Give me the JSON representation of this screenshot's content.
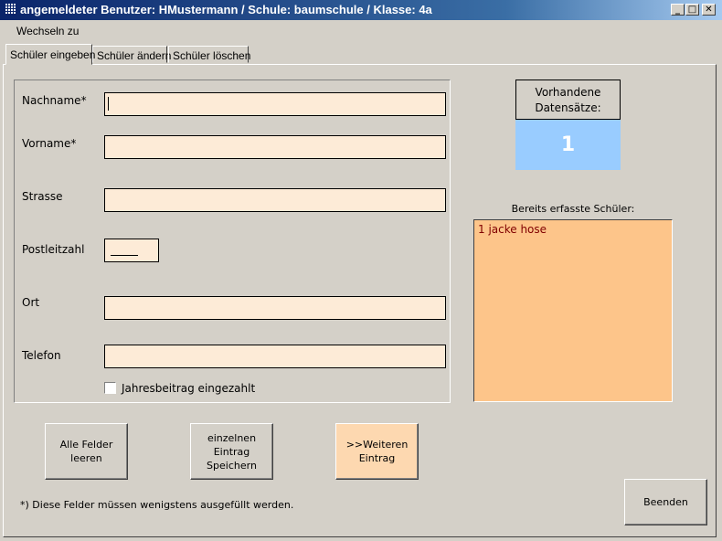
{
  "window": {
    "title": "angemeldeter Benutzer: HMustermann / Schule: baumschule / Klasse: 4a",
    "minimize": "_",
    "maximize": "□",
    "close": "✕"
  },
  "menu": {
    "switch": "Wechseln zu"
  },
  "tabs": [
    {
      "label": "Schüler eingeben",
      "active": true
    },
    {
      "label": "Schüler ändern",
      "active": false
    },
    {
      "label": "Schüler löschen",
      "active": false
    }
  ],
  "form": {
    "lastname_label": "Nachname*",
    "firstname_label": "Vorname*",
    "street_label": "Strasse",
    "zip_label": "Postleitzahl",
    "city_label": "Ort",
    "phone_label": "Telefon",
    "lastname_value": "",
    "firstname_value": "",
    "street_value": "",
    "zip_value": "",
    "city_value": "",
    "phone_value": "",
    "fee_paid_label": "Jahresbeitrag eingezahlt",
    "fee_paid_checked": false
  },
  "buttons": {
    "clear": "Alle Felder\nleeren",
    "save": "einzelnen\nEintrag\nSpeichern",
    "next": ">>Weiteren\nEintrag",
    "quit": "Beenden"
  },
  "records": {
    "label": "Vorhandene\nDatensätze:",
    "count": "1"
  },
  "students": {
    "label": "Bereits erfasste Schüler:",
    "items": [
      "1 jacke hose"
    ]
  },
  "footnote": "*) Diese Felder müssen wenigstens ausgefüllt werden.",
  "colors": {
    "field_bg": "#fdebd7",
    "count_bg": "#99ccff",
    "list_bg": "#fdc58a",
    "list_text": "#800000",
    "next_button_bg": "#fdd8b0",
    "window_bg": "#d4d0c8"
  }
}
